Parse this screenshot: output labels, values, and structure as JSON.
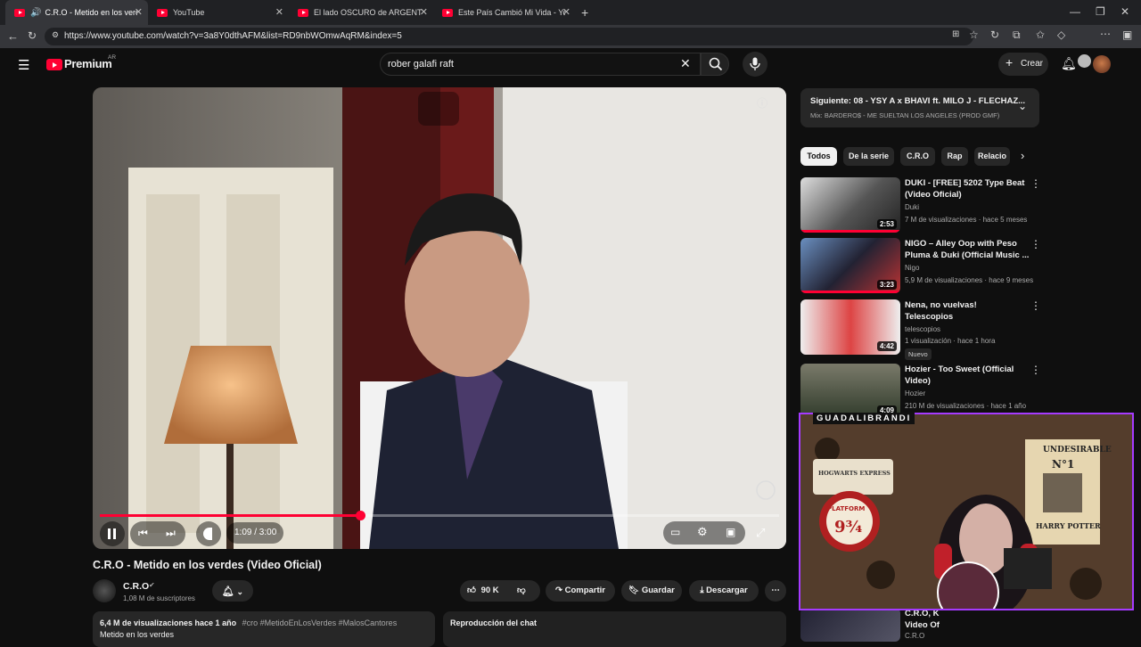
{
  "browser": {
    "tabs": [
      {
        "title": "C.R.O - Metido en los verdes",
        "active": true
      },
      {
        "title": "YouTube",
        "active": false
      },
      {
        "title": "El lado OSCURO de ARGENTINA #",
        "active": false
      },
      {
        "title": "Este País Cambió Mi Vida - YouTub",
        "active": false
      }
    ],
    "url": "https://www.youtube.com/watch?v=3a8Y0dthAFM&list=RD9nbWOmwAqRM&index=5"
  },
  "header": {
    "logo_text": "Premium",
    "region": "AR",
    "search_value": "rober galafi raft",
    "create_label": "Crear"
  },
  "player": {
    "time": "1:09 / 3:00",
    "progress": 0.383
  },
  "video": {
    "title": "C.R.O - Metido en los verdes (Video Oficial)",
    "channel": "C.R.O",
    "subscribers": "1,08 M de suscriptores",
    "likes": "90 K",
    "share_label": "Compartir",
    "save_label": "Guardar",
    "download_label": "Descargar",
    "description_stats": "6,4 M de visualizaciones  hace 1 año",
    "description_tags": "#cro #MetidoEnLosVerdes #MalosCantores",
    "description_text": "Metido en los verdes",
    "chat_label": "Reproducción del chat"
  },
  "sidebar": {
    "next_title": "Siguiente: 08 - YSY A x BHAVI ft. MILO J - FLECHAZ...",
    "next_sub": "Mix: BARDERO$ - ME SUELTAN LOS ANGELES (PROD GMF)",
    "chips": [
      "Todos",
      "De la serie",
      "C.R.O",
      "Rap",
      "Relacio"
    ],
    "recommendations": [
      {
        "title_line1": "DUKI - [FREE] 5202 Type Beat",
        "title_line2": "(Video Oficial)",
        "channel": "Duki",
        "meta": "7 M de visualizaciones · hace 5 meses",
        "duration": "2:53"
      },
      {
        "title_line1": "NIGO – Alley Oop with Peso",
        "title_line2": "Pluma & Duki (Official Music ...",
        "channel": "Nigo",
        "meta": "5,9 M de visualizaciones · hace 9 meses",
        "duration": "3:23"
      },
      {
        "title_line1": "Nena, no vuelvas!",
        "title_line2": "Telescopios",
        "channel": "telescopios",
        "meta": "1 visualización · hace 1 hora",
        "duration": "4:42",
        "badge": "Nuevo"
      },
      {
        "title_line1": "Hozier - Too Sweet (Official",
        "title_line2": "Video)",
        "channel": "Hozier",
        "meta": "210 M de visualizaciones · hace 1 año",
        "duration": "4:09"
      },
      {
        "title_line1": "C.R.O, K",
        "title_line2": "Video Of",
        "channel": "C.R.O",
        "meta": "",
        "duration": ""
      }
    ]
  },
  "overlay": {
    "streamer_name": "GUADALIBRANDI",
    "poster_title": "UNDESIRABLE",
    "poster_no": "N°1",
    "poster_name": "HARRY POTTER",
    "sign_top": "HOGWARTS EXPRESS",
    "sign_main": "PLATFORM",
    "sign_number": "9¾"
  }
}
